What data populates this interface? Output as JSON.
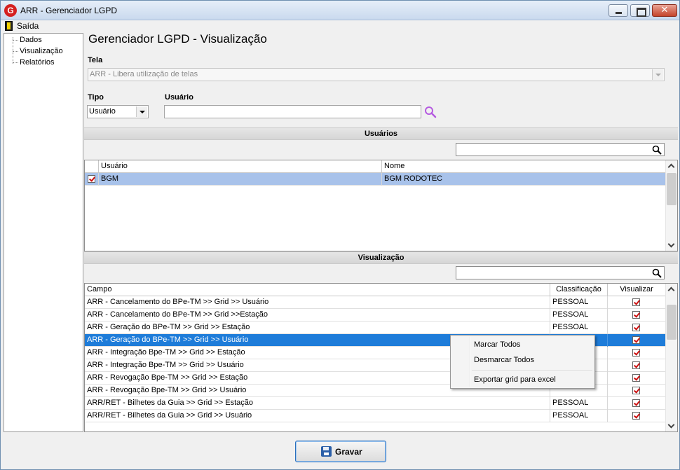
{
  "window": {
    "title": "ARR - Gerenciador LGPD",
    "app_icon_letter": "G",
    "buttons": {
      "minimize": "minimize",
      "maximize": "maximize",
      "close": "✕"
    }
  },
  "menu": {
    "exit_label": "Saída"
  },
  "tree": {
    "items": [
      {
        "label": "Dados"
      },
      {
        "label": "Visualização"
      },
      {
        "label": "Relatórios"
      }
    ]
  },
  "page": {
    "title": "Gerenciador LGPD - Visualização",
    "tela_label": "Tela",
    "tela_value": "ARR - Libera utilização de telas",
    "tipo_label": "Tipo",
    "tipo_value": "Usuário",
    "usuario_label": "Usuário",
    "usuario_value": ""
  },
  "users_section": {
    "title": "Usuários",
    "filter_value": "",
    "columns": [
      "Usuário",
      "Nome"
    ],
    "rows": [
      {
        "checked": true,
        "usuario": "BGM",
        "nome": "BGM RODOTEC"
      }
    ]
  },
  "view_section": {
    "title": "Visualização",
    "filter_value": "",
    "columns": [
      "Campo",
      "Classificação",
      "Visualizar"
    ],
    "rows": [
      {
        "campo": "ARR - Cancelamento do BPe-TM >> Grid >> Usuário",
        "classificacao": "PESSOAL",
        "visualizar": true
      },
      {
        "campo": "ARR - Cancelamento do BPe-TM >> Grid >>Estação",
        "classificacao": "PESSOAL",
        "visualizar": true
      },
      {
        "campo": "ARR - Geração do BPe-TM >> Grid >> Estação",
        "classificacao": "PESSOAL",
        "visualizar": true
      },
      {
        "campo": "ARR - Geração do BPe-TM >> Grid >> Usuário",
        "classificacao": "",
        "visualizar": true
      },
      {
        "campo": "ARR - Integração Bpe-TM >> Grid >> Estação",
        "classificacao": "",
        "visualizar": true
      },
      {
        "campo": "ARR - Integração Bpe-TM >> Grid >> Usuário",
        "classificacao": "",
        "visualizar": true
      },
      {
        "campo": "ARR - Revogação Bpe-TM >> Grid >> Estação",
        "classificacao": "",
        "visualizar": true
      },
      {
        "campo": "ARR - Revogação Bpe-TM >> Grid >> Usuário",
        "classificacao": "",
        "visualizar": true
      },
      {
        "campo": "ARR/RET - Bilhetes da Guia >> Grid >> Estação",
        "classificacao": "PESSOAL",
        "visualizar": true
      },
      {
        "campo": "ARR/RET - Bilhetes da Guia >> Grid >> Usuário",
        "classificacao": "PESSOAL",
        "visualizar": true
      }
    ],
    "selected_row": 3
  },
  "context_menu": {
    "items": [
      "Marcar Todos",
      "Desmarcar Todos",
      "Exportar grid para excel"
    ]
  },
  "save_button": {
    "label": "Gravar"
  },
  "colors": {
    "selection": "#1e7cd9",
    "selection_light": "#a8c2ea",
    "check": "#cc1111"
  }
}
